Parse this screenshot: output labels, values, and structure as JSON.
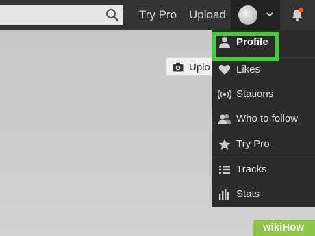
{
  "header": {
    "nav": {
      "try_pro": "Try Pro",
      "upload": "Upload"
    },
    "icons": {
      "search": "search-icon",
      "chevron": "chevron-down-icon",
      "bell": "notifications-bell-icon"
    },
    "notification_dot_color": "#ff5500"
  },
  "hero": {
    "upload_button_label": "Uplo",
    "icon": "camera-icon"
  },
  "dropdown": {
    "items": [
      {
        "label": "Profile",
        "icon": "user-icon",
        "highlighted": true
      },
      {
        "label": "Likes",
        "icon": "heart-icon"
      },
      {
        "label": "Stations",
        "icon": "broadcast-icon"
      },
      {
        "label": "Who to follow",
        "icon": "users-icon"
      },
      {
        "label": "Try Pro",
        "icon": "star-icon"
      },
      {
        "label": "Tracks",
        "icon": "list-icon"
      },
      {
        "label": "Stats",
        "icon": "bar-chart-icon"
      }
    ]
  },
  "highlight_color": "#38d42c",
  "watermark": {
    "text": "wikiHow",
    "color": "#8ec64a"
  }
}
